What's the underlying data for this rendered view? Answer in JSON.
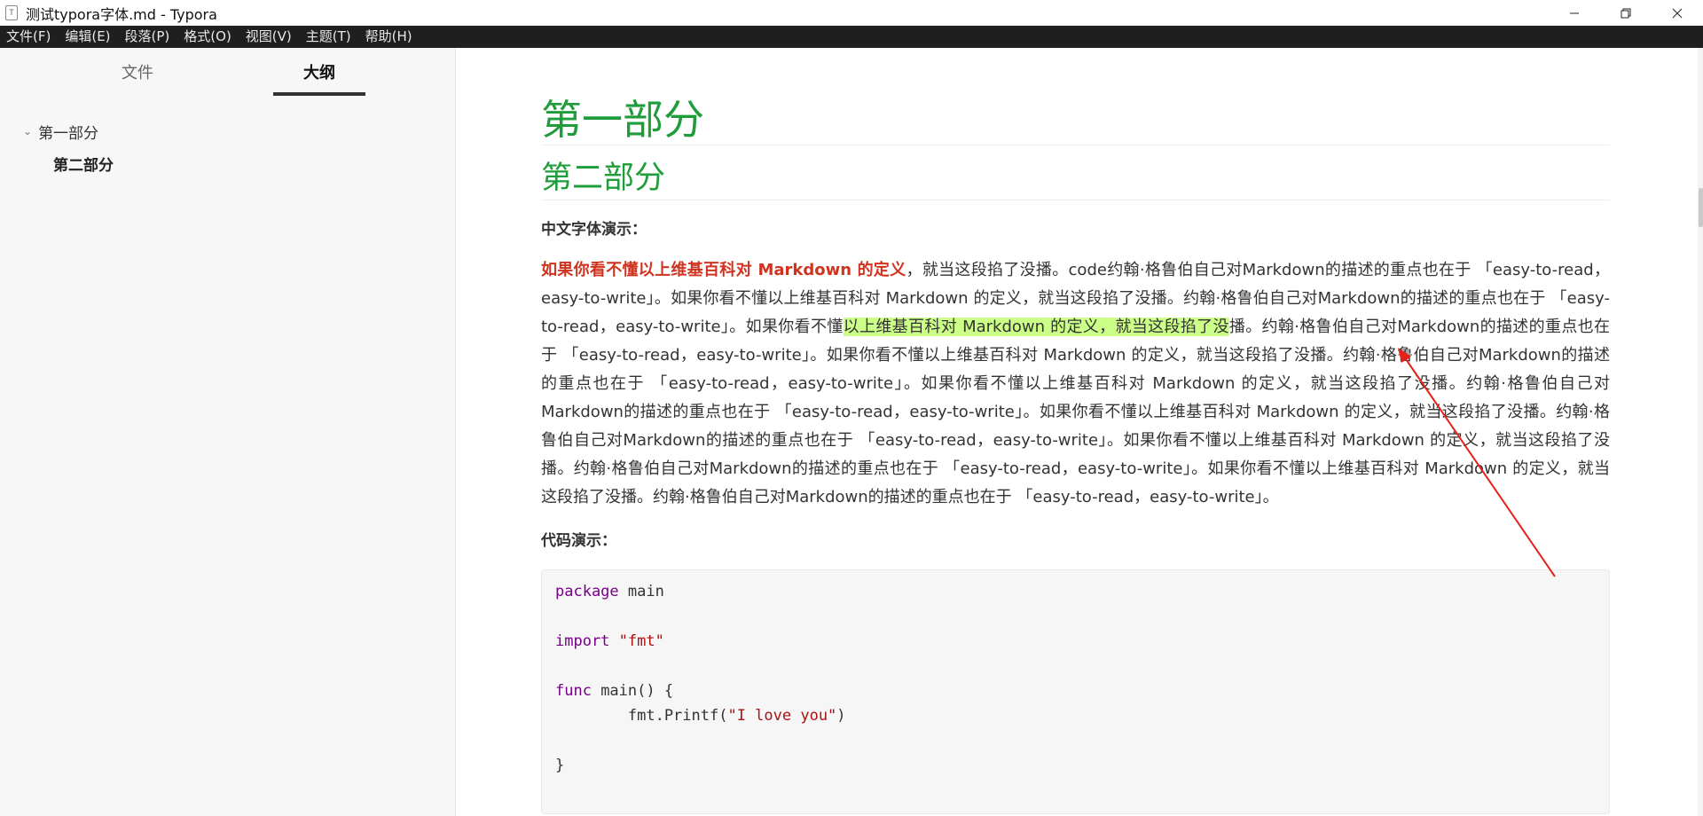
{
  "window": {
    "icon": "T",
    "title": "测试typora字体.md - Typora"
  },
  "menubar": {
    "items": [
      "文件(F)",
      "编辑(E)",
      "段落(P)",
      "格式(O)",
      "视图(V)",
      "主题(T)",
      "帮助(H)"
    ]
  },
  "sidebar": {
    "tabs": {
      "files": "文件",
      "outline": "大纲"
    },
    "outline": [
      {
        "label": "第一部分",
        "expanded": true
      },
      {
        "label": "第二部分"
      }
    ]
  },
  "document": {
    "h1": "第一部分",
    "h2": "第二部分",
    "font_demo_label": "中文字体演示：",
    "para": {
      "red": "如果你看不懂以上维基百科对 Markdown 的定义",
      "part1": "，就当这段掐了没播。code约翰·格鲁伯自己对Markdown的描述的重点也在于 「easy-to-read，easy-to-write」。如果你看不懂以上维基百科对 Markdown 的定义，就当这段掐了没播。约翰·格鲁伯自己对Markdown的描述的重点也在于 「easy-to-read，easy-to-write」。如果你看不懂",
      "highlight": "以上维基百科对 Markdown 的定义，就当这段掐了没",
      "part2": "播。约翰·格鲁伯自己对Markdown的描述的重点也在于 「easy-to-read，easy-to-write」。如果你看不懂以上维基百科对 Markdown 的定义，就当这段掐了没播。约翰·格鲁伯自己对Markdown的描述的重点也在于 「easy-to-read，easy-to-write」。如果你看不懂以上维基百科对 Markdown 的定义，就当这段掐了没播。约翰·格鲁伯自己对Markdown的描述的重点也在于 「easy-to-read，easy-to-write」。如果你看不懂以上维基百科对 Markdown 的定义，就当这段掐了没播。约翰·格鲁伯自己对Markdown的描述的重点也在于 「easy-to-read，easy-to-write」。如果你看不懂以上维基百科对 Markdown 的定义，就当这段掐了没播。约翰·格鲁伯自己对Markdown的描述的重点也在于 「easy-to-read，easy-to-write」。如果你看不懂以上维基百科对 Markdown 的定义，就当这段掐了没播。约翰·格鲁伯自己对Markdown的描述的重点也在于 「easy-to-read，easy-to-write」。"
    },
    "code_demo_label": "代码演示：",
    "code": {
      "kw_package": "package",
      "pkg_name": " main",
      "kw_import": "import",
      "import_str": "\"fmt\"",
      "kw_func": "func",
      "func_sig": " main() {",
      "call": "        fmt.Printf(",
      "call_str": "\"I love you\"",
      "call_end": ")",
      "close": "}"
    }
  },
  "colors": {
    "heading": "#1f9d3a",
    "red_text": "#d0331f",
    "highlight": "#ccff88",
    "annotation_arrow": "#e8201a"
  },
  "icons": {
    "minimize": "minimize-icon",
    "restore": "restore-icon",
    "close": "close-icon",
    "caret": "chevron-down-icon"
  }
}
